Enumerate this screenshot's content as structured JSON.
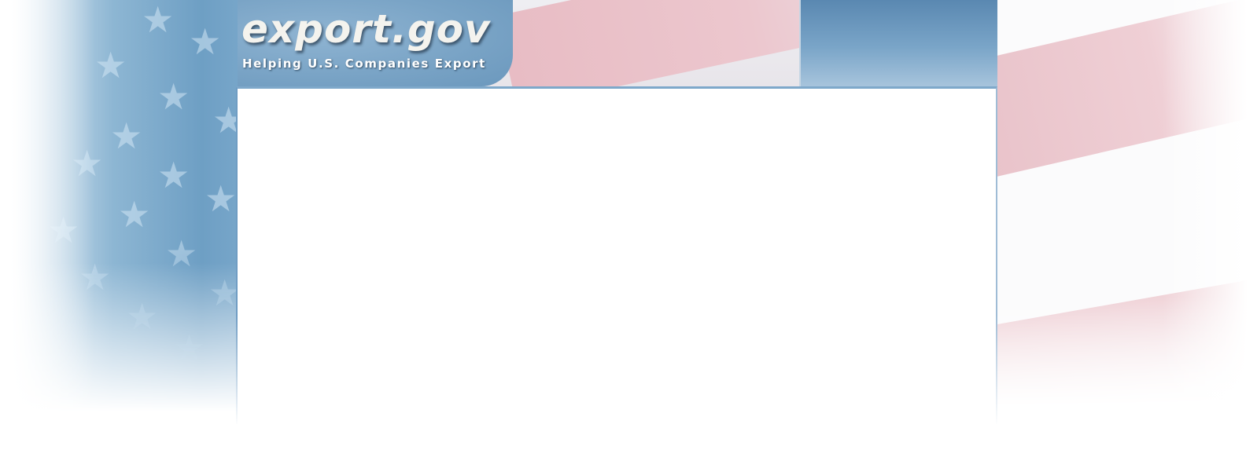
{
  "site": {
    "title": "export.gov",
    "tagline": "Helping U.S. Companies Export"
  },
  "icons": {
    "background": "us-flag-stars-stripes",
    "star_glyph": "★"
  },
  "colors": {
    "flag_blue": "#7aa4c6",
    "flag_red": "#e9c3ca",
    "frame_border": "#6f9cc3",
    "panel_blue": "#5a88b1"
  }
}
